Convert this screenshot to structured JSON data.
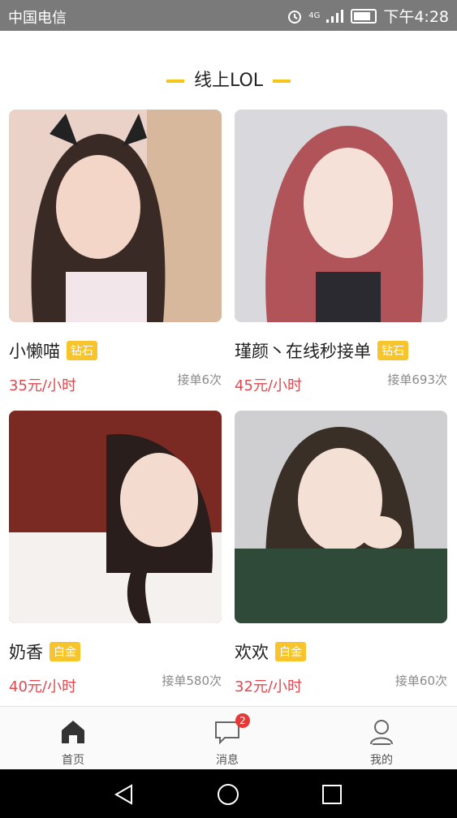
{
  "status_bar": {
    "carrier": "中国电信",
    "network": "4G",
    "time": "下午4:28"
  },
  "section": {
    "title": "线上LOL"
  },
  "cards": [
    {
      "name": "小懒喵",
      "badge": "钻石",
      "price": "35元/小时",
      "orders": "接单6次"
    },
    {
      "name": "瑾颜丶在线秒接单",
      "badge": "钻石",
      "price": "45元/小时",
      "orders": "接单693次"
    },
    {
      "name": "奶香",
      "badge": "白金",
      "price": "40元/小时",
      "orders": "接单580次"
    },
    {
      "name": "欢欢",
      "badge": "白金",
      "price": "32元/小时",
      "orders": "接单60次"
    }
  ],
  "tabbar": {
    "home": {
      "label": "首页"
    },
    "messages": {
      "label": "消息",
      "badge": "2"
    },
    "profile": {
      "label": "我的"
    }
  },
  "colors": {
    "accent": "#f5c518",
    "price": "#e0484d",
    "badge": "#f7c52b",
    "badge_alert": "#e53935"
  }
}
